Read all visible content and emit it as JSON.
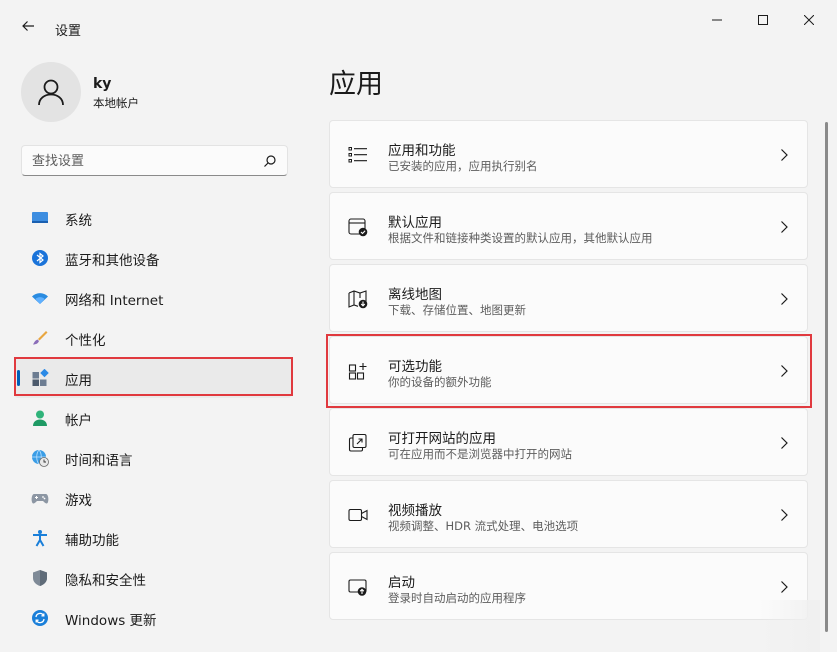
{
  "window": {
    "title": "设置"
  },
  "user": {
    "name": "ky",
    "account_type": "本地帐户"
  },
  "search": {
    "placeholder": "查找设置"
  },
  "nav": {
    "items": [
      {
        "label": "系统",
        "icon": "system-icon"
      },
      {
        "label": "蓝牙和其他设备",
        "icon": "bluetooth-icon"
      },
      {
        "label": "网络和 Internet",
        "icon": "wifi-icon"
      },
      {
        "label": "个性化",
        "icon": "brush-icon"
      },
      {
        "label": "应用",
        "icon": "apps-icon"
      },
      {
        "label": "帐户",
        "icon": "account-icon"
      },
      {
        "label": "时间和语言",
        "icon": "globe-clock-icon"
      },
      {
        "label": "游戏",
        "icon": "gamepad-icon"
      },
      {
        "label": "辅助功能",
        "icon": "accessibility-icon"
      },
      {
        "label": "隐私和安全性",
        "icon": "shield-icon"
      },
      {
        "label": "Windows 更新",
        "icon": "update-icon"
      }
    ],
    "selected_index": 4
  },
  "main": {
    "title": "应用",
    "cards": [
      {
        "title": "应用和功能",
        "subtitle": "已安装的应用，应用执行别名",
        "icon": "list-icon"
      },
      {
        "title": "默认应用",
        "subtitle": "根据文件和链接种类设置的默认应用，其他默认应用",
        "icon": "default-app-icon"
      },
      {
        "title": "离线地图",
        "subtitle": "下载、存储位置、地图更新",
        "icon": "map-icon"
      },
      {
        "title": "可选功能",
        "subtitle": "你的设备的额外功能",
        "icon": "optional-features-icon"
      },
      {
        "title": "可打开网站的应用",
        "subtitle": "可在应用而不是浏览器中打开的网站",
        "icon": "open-external-icon"
      },
      {
        "title": "视频播放",
        "subtitle": "视频调整、HDR 流式处理、电池选项",
        "icon": "video-icon"
      },
      {
        "title": "启动",
        "subtitle": "登录时自动启动的应用程序",
        "icon": "startup-icon"
      }
    ]
  },
  "colors": {
    "accent": "#005fb8",
    "highlight_box": "#e0393e",
    "background": "#f3f3f3",
    "card": "#fbfbfb"
  }
}
